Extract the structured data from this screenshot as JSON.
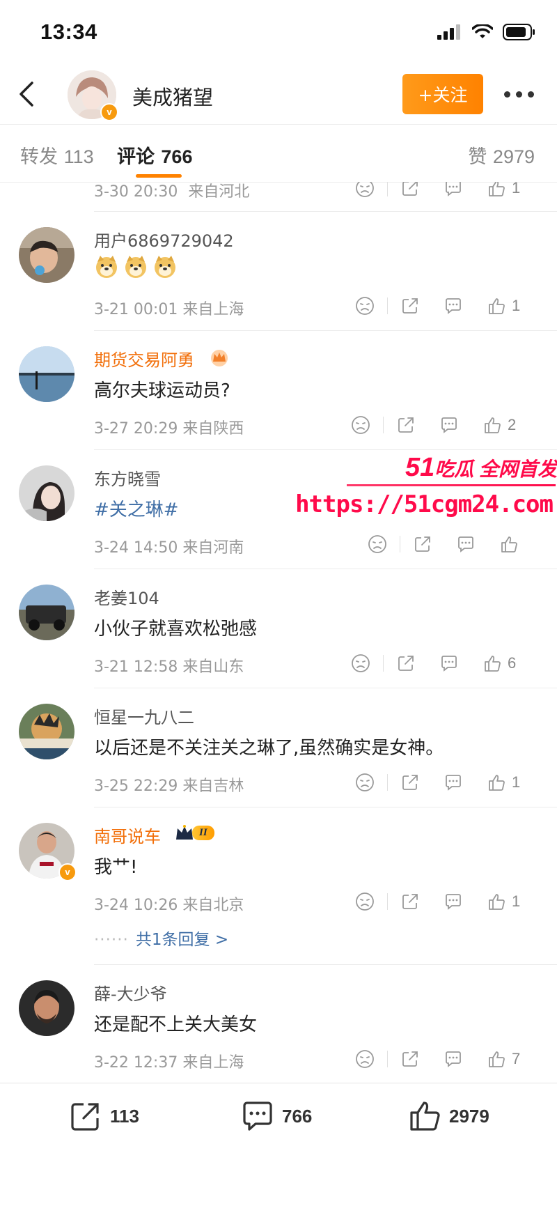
{
  "status": {
    "time": "13:34"
  },
  "header": {
    "username": "美成猪望",
    "follow_label": "+关注"
  },
  "tabs": {
    "repost_label": "转发",
    "repost_count": "113",
    "comment_label": "评论",
    "comment_count": "766",
    "like_label": "赞",
    "like_count": "2979"
  },
  "partial": {
    "time": "3-30 20:30",
    "location": "来自河北",
    "likes": "1"
  },
  "comments": [
    {
      "name": "用户6869729042",
      "text": "",
      "emoji": [
        "doge",
        "doge",
        "doge"
      ],
      "time": "3-21 00:01",
      "location": "来自上海",
      "likes": "1"
    },
    {
      "name": "期货交易阿勇",
      "text": "高尔夫球运动员?",
      "time": "3-27 20:29",
      "location": "来自陕西",
      "likes": "2"
    },
    {
      "name": "东方晓雪",
      "text": "#关之琳#",
      "time": "3-24 14:50",
      "location": "来自河南",
      "likes": ""
    },
    {
      "name": "老姜104",
      "text": "小伙子就喜欢松弛感",
      "time": "3-21 12:58",
      "location": "来自山东",
      "likes": "6"
    },
    {
      "name": "恒星一九八二",
      "text": "以后还是不关注关之琳了,虽然确实是女神。",
      "time": "3-25 22:29",
      "location": "来自吉林",
      "likes": "1"
    },
    {
      "name": "南哥说车",
      "text": "我艹!",
      "time": "3-24 10:26",
      "location": "来自北京",
      "likes": "1",
      "reply_link": "共1条回复 >",
      "badge": "II"
    },
    {
      "name": "薛-大少爷",
      "text": "还是配不上关大美女",
      "time": "3-22 12:37",
      "location": "来自上海",
      "likes": "7"
    }
  ],
  "bottom": {
    "repost": "113",
    "comment": "766",
    "like": "2979"
  },
  "watermark": {
    "num": "51",
    "title": "吃瓜 全网首发",
    "url": "https://51cgm24.com"
  },
  "colors": {
    "accent": "#ff8200",
    "vip_name": "#f26f0a",
    "topic": "#3f6ea6",
    "watermark": "#ff0a4a"
  }
}
